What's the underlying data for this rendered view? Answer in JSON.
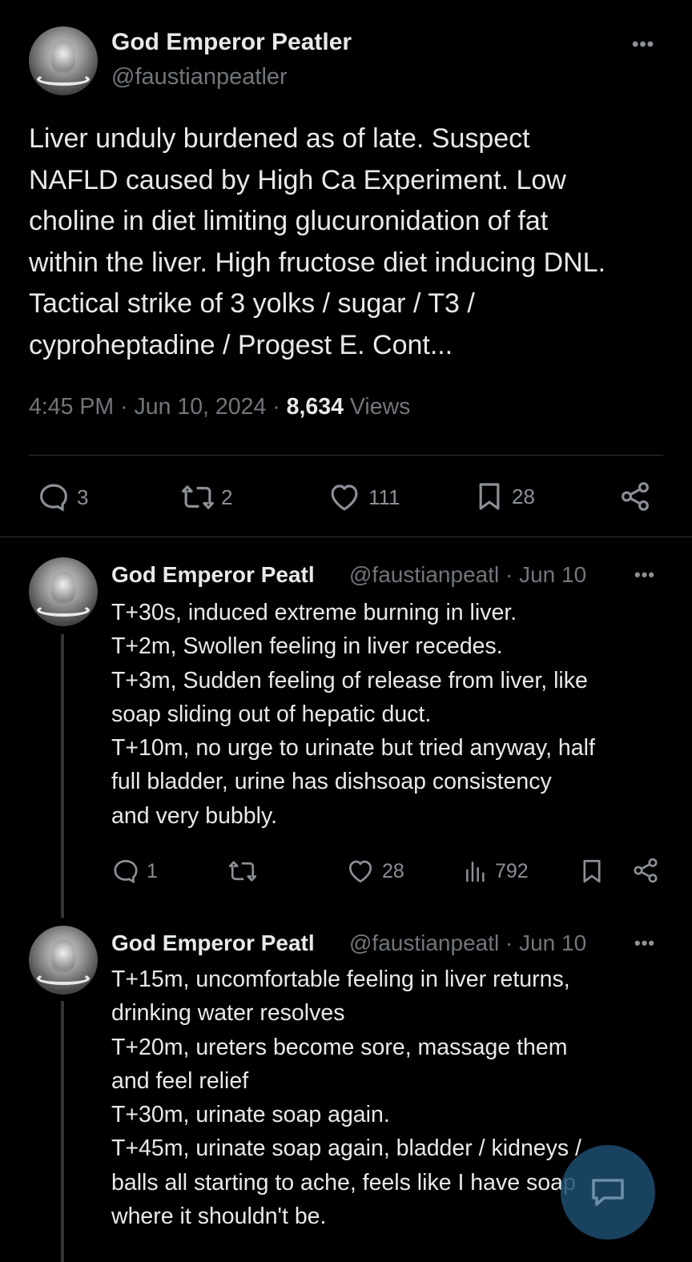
{
  "main_tweet": {
    "author_name": "God Emperor Peatler",
    "handle": "@faustianpeatler",
    "text": "Liver unduly burdened as of late. Suspect\nNAFLD caused by High Ca Experiment. Low\ncholine in diet limiting glucuronidation of fat\nwithin the liver. High fructose diet inducing DNL.\nTactical strike of 3 yolks / sugar / T3 /\ncyproheptadine / Progest E. Cont...",
    "time": "4:45 PM",
    "date": "Jun 10, 2024",
    "views_count": "8,634",
    "views_label": "Views",
    "separator": "·",
    "more_label": "•••",
    "actions": {
      "replies": "3",
      "retweets": "2",
      "likes": "111",
      "bookmarks": "28"
    }
  },
  "replies": [
    {
      "author_name": "God Emperor Peatl",
      "handle_date": "@faustianpeatl · Jun 10",
      "more_label": "•••",
      "text": "T+30s, induced extreme burning in liver.\nT+2m, Swollen feeling in liver recedes.\nT+3m, Sudden feeling of release from liver, like\nsoap sliding out of hepatic duct.\nT+10m, no urge to urinate but tried anyway, half\nfull bladder, urine has dishsoap consistency\nand very bubbly.",
      "actions": {
        "replies": "1",
        "likes": "28",
        "views": "792"
      }
    },
    {
      "author_name": "God Emperor Peatl",
      "handle_date": "@faustianpeatl · Jun 10",
      "more_label": "•••",
      "text": "T+15m, uncomfortable feeling in liver returns,\ndrinking water resolves\nT+20m, ureters become sore, massage them\nand feel relief\nT+30m, urinate soap again.\nT+45m, urinate soap again, bladder / kidneys /\nballs all starting to ache, feels like I have soap\nwhere it shouldn't be."
    }
  ],
  "colors": {
    "background": "#000000",
    "text_primary": "#e7e9ea",
    "text_secondary": "#71767b",
    "divider": "#2f3336",
    "fab": "#1d4e70"
  }
}
